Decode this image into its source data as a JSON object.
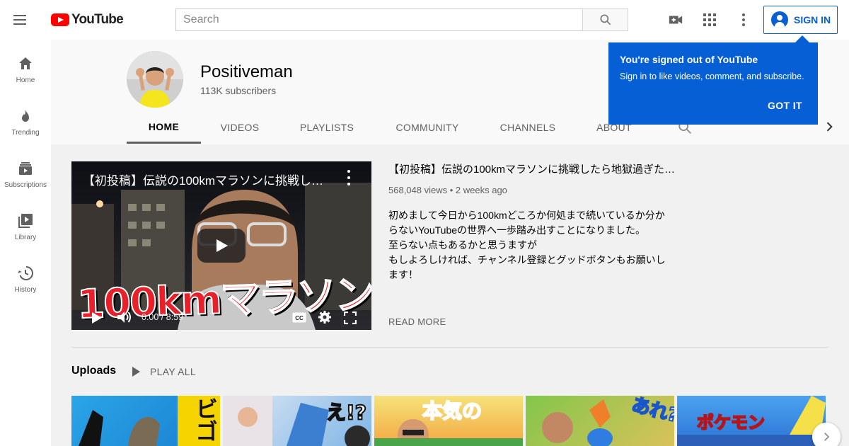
{
  "header": {
    "logo_text": "YouTube",
    "search_placeholder": "Search",
    "sign_in_label": "SIGN IN"
  },
  "sidebar": {
    "items": [
      {
        "label": "Home",
        "icon": "home-icon"
      },
      {
        "label": "Trending",
        "icon": "fire-icon"
      },
      {
        "label": "Subscriptions",
        "icon": "subscriptions-icon"
      },
      {
        "label": "Library",
        "icon": "library-icon"
      },
      {
        "label": "History",
        "icon": "history-icon"
      }
    ]
  },
  "channel": {
    "name": "Positiveman",
    "subscribers": "113K subscribers",
    "tabs": [
      "HOME",
      "VIDEOS",
      "PLAYLISTS",
      "COMMUNITY",
      "CHANNELS",
      "ABOUT"
    ],
    "active_tab": "HOME"
  },
  "popup": {
    "title": "You're signed out of YouTube",
    "body": "Sign in to like videos, comment, and subscribe.",
    "button": "GOT IT"
  },
  "featured": {
    "player_title": "【初投稿】伝説の100kmマラソンに挑戦し…",
    "overlay_text": "100kmマラソン",
    "time": "0:00 / 8:59",
    "title": "【初投稿】伝説の100kmマラソンに挑戦したら地獄過ぎた…",
    "views": "568,048 views",
    "age": "2 weeks ago",
    "description": [
      "初めまして今日から100kmどころか何処まで続いているか分か",
      "らないYouTubeの世界へ一歩踏み出すことになりました。",
      "至らない点もあるかと思うますが",
      "もしよろしければ、チャンネル登録とグッドボタンもお願いし",
      "ます！"
    ],
    "read_more": "READ MORE"
  },
  "uploads": {
    "title": "Uploads",
    "play_all": "PLAY ALL",
    "thumbnails": [
      {
        "text": "ビゴ"
      },
      {
        "text": "え!?"
      },
      {
        "text": "本気の"
      },
      {
        "text": "あれ?"
      },
      {
        "text": "ポケモン"
      }
    ]
  },
  "colors": {
    "accent": "#065fd4",
    "brand_red": "#ff0000",
    "text_secondary": "#606060"
  }
}
